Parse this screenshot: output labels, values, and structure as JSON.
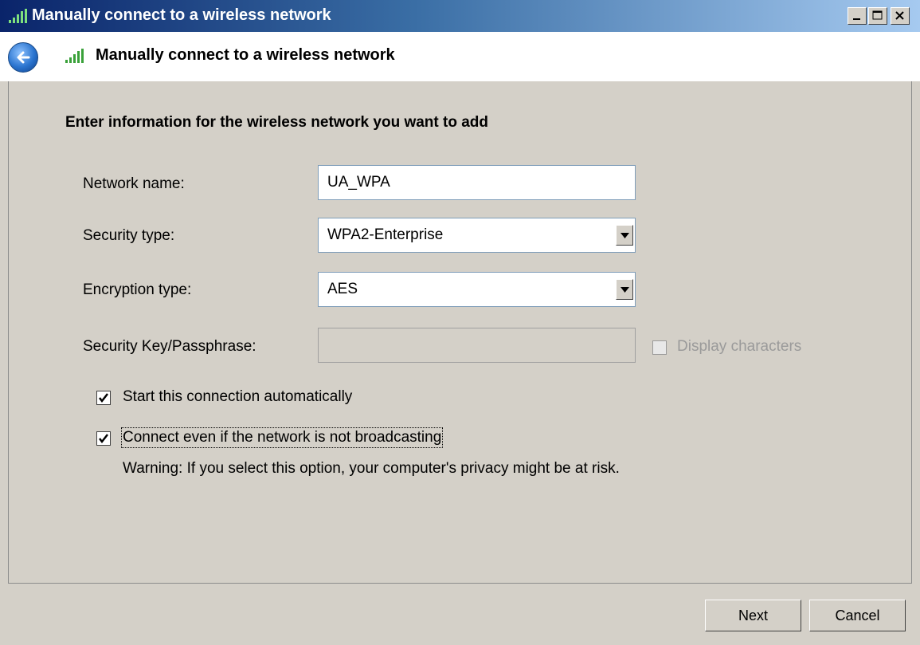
{
  "window": {
    "title": "Manually connect to a wireless network",
    "controls": [
      "minimize",
      "maximize",
      "close"
    ]
  },
  "header": {
    "title": "Manually connect to a wireless network",
    "back_icon": "back-arrow-icon"
  },
  "form": {
    "heading": "Enter information for the wireless network you want to add",
    "network_name": {
      "label": "Network name:",
      "value": "UA_WPA"
    },
    "security_type": {
      "label": "Security type:",
      "value": "WPA2-Enterprise"
    },
    "encryption_type": {
      "label": "Encryption type:",
      "value": "AES"
    },
    "security_key": {
      "label": "Security Key/Passphrase:",
      "value": "",
      "enabled": false
    },
    "display_characters": {
      "label": "Display characters",
      "checked": false,
      "enabled": false
    },
    "start_automatically": {
      "label": "Start this connection automatically",
      "checked": true
    },
    "connect_not_broadcasting": {
      "label": "Connect even if the network is not broadcasting",
      "checked": true
    },
    "warning": "Warning: If you select this option, your computer's privacy might be at risk."
  },
  "buttons": {
    "next": "Next",
    "cancel": "Cancel"
  },
  "colors": {
    "titlebar_start": "#0a246a",
    "titlebar_end": "#a6caf0",
    "dialog_bg": "#d4d0c8",
    "signal_green": "#3aa13a"
  }
}
